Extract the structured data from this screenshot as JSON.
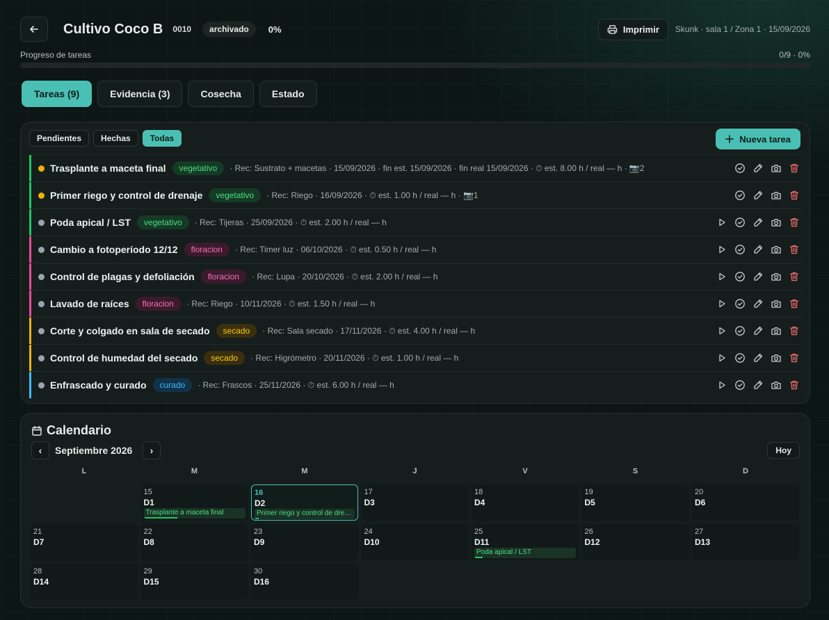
{
  "header": {
    "title": "Cultivo Coco B",
    "code": "0010",
    "status_badge": "archivado",
    "percent": "0%",
    "print_label": "Imprimir",
    "meta": "Skunk · sala 1 / Zona 1 · 15/09/2026"
  },
  "progress": {
    "label": "Progreso de tareas",
    "value_text": "0/9 · 0%",
    "fraction": 0
  },
  "tabs": [
    {
      "label": "Tareas (9)",
      "active": true
    },
    {
      "label": "Evidencia (3)",
      "active": false
    },
    {
      "label": "Cosecha",
      "active": false
    },
    {
      "label": "Estado",
      "active": false
    }
  ],
  "filters": [
    {
      "label": "Pendientes",
      "active": false
    },
    {
      "label": "Hechas",
      "active": false
    },
    {
      "label": "Todas",
      "active": true
    }
  ],
  "new_task_label": "Nueva tarea",
  "phase_colors": {
    "vegetativo": {
      "stripe": "#22c55e",
      "bg": "#153a26",
      "fg": "#4ade80"
    },
    "floracion": {
      "stripe": "#ec4899",
      "bg": "#3c1a2d",
      "fg": "#f472b6"
    },
    "secado": {
      "stripe": "#eab308",
      "bg": "#3a2f0f",
      "fg": "#facc15"
    },
    "curado": {
      "stripe": "#38bdf8",
      "bg": "#12324a",
      "fg": "#38bdf8"
    }
  },
  "tasks": [
    {
      "name": "Trasplante a maceta final",
      "phase": "vegetativo",
      "dot": "#eab308",
      "info": "· Rec: Sustrato + macetas · 15/09/2026 · fin est. 15/09/2026 · fin real 15/09/2026 · ⏱ est. 8.00 h / real — h · 📷2",
      "play": false
    },
    {
      "name": "Primer riego y control de drenaje",
      "phase": "vegetativo",
      "dot": "#eab308",
      "info": "· Rec: Riego · 16/09/2026 · ⏱ est. 1.00 h / real — h · 📷1",
      "play": false
    },
    {
      "name": "Poda apical / LST",
      "phase": "vegetativo",
      "dot": "#9ca3af",
      "info": "· Rec: Tijeras · 25/09/2026 · ⏱ est. 2.00 h / real — h",
      "play": true
    },
    {
      "name": "Cambio a fotoperíodo 12/12",
      "phase": "floracion",
      "dot": "#9ca3af",
      "info": "· Rec: Timer luz · 06/10/2026 · ⏱ est. 0.50 h / real — h",
      "play": true
    },
    {
      "name": "Control de plagas y defoliación",
      "phase": "floracion",
      "dot": "#9ca3af",
      "info": "· Rec: Lupa · 20/10/2026 · ⏱ est. 2.00 h / real — h",
      "play": true
    },
    {
      "name": "Lavado de raíces",
      "phase": "floracion",
      "dot": "#9ca3af",
      "info": "· Rec: Riego · 10/11/2026 · ⏱ est. 1.50 h / real — h",
      "play": true
    },
    {
      "name": "Corte y colgado en sala de secado",
      "phase": "secado",
      "dot": "#9ca3af",
      "info": "· Rec: Sala secado · 17/11/2026 · ⏱ est. 4.00 h / real — h",
      "play": true
    },
    {
      "name": "Control de humedad del secado",
      "phase": "secado",
      "dot": "#9ca3af",
      "info": "· Rec: Higrómetro · 20/11/2026 · ⏱ est. 1.00 h / real — h",
      "play": true
    },
    {
      "name": "Enfrascado y curado",
      "phase": "curado",
      "dot": "#9ca3af",
      "info": "· Rec: Frascos · 25/11/2026 · ⏱ est. 6.00 h / real — h",
      "play": true
    }
  ],
  "calendar": {
    "title": "Calendario",
    "month": "Septiembre 2026",
    "prev": "‹",
    "next": "›",
    "today_label": "Hoy",
    "weekdays": [
      "L",
      "M",
      "M",
      "J",
      "V",
      "S",
      "D"
    ],
    "days": [
      {
        "num": "15",
        "label": "D1",
        "col": 1,
        "row": 0,
        "event": "Trasplante a maceta final",
        "event_progress": 0.33
      },
      {
        "num": "16",
        "label": "D2",
        "col": 2,
        "row": 0,
        "today": true,
        "event": "Primer riego y control de drenaje",
        "event_progress": 0.04
      },
      {
        "num": "17",
        "label": "D3",
        "col": 3,
        "row": 0
      },
      {
        "num": "18",
        "label": "D4",
        "col": 4,
        "row": 0
      },
      {
        "num": "19",
        "label": "D5",
        "col": 5,
        "row": 0
      },
      {
        "num": "20",
        "label": "D6",
        "col": 6,
        "row": 0
      },
      {
        "num": "21",
        "label": "D7",
        "col": 0,
        "row": 1
      },
      {
        "num": "22",
        "label": "D8",
        "col": 1,
        "row": 1
      },
      {
        "num": "23",
        "label": "D9",
        "col": 2,
        "row": 1
      },
      {
        "num": "24",
        "label": "D10",
        "col": 3,
        "row": 1
      },
      {
        "num": "25",
        "label": "D11",
        "col": 4,
        "row": 1,
        "event": "Poda apical / LST",
        "event_progress": 0.08
      },
      {
        "num": "26",
        "label": "D12",
        "col": 5,
        "row": 1
      },
      {
        "num": "27",
        "label": "D13",
        "col": 6,
        "row": 1
      },
      {
        "num": "28",
        "label": "D14",
        "col": 0,
        "row": 2
      },
      {
        "num": "29",
        "label": "D15",
        "col": 1,
        "row": 2
      },
      {
        "num": "30",
        "label": "D16",
        "col": 2,
        "row": 2
      }
    ]
  }
}
